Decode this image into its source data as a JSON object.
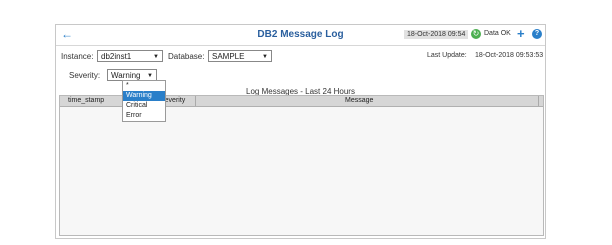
{
  "header": {
    "title": "DB2 Message Log",
    "datetime": "18-Oct-2018 09:54",
    "status_label": "Data OK"
  },
  "filters": {
    "instance_label": "Instance:",
    "instance_value": "db2inst1",
    "database_label": "Database:",
    "database_value": "SAMPLE",
    "last_update_label": "Last Update:",
    "last_update_value": "18-Oct-2018 09:53:53",
    "severity_label": "Severity:",
    "severity_value": "Warning"
  },
  "severity_dropdown": {
    "options": [
      "*",
      "Warning",
      "Critical",
      "Error"
    ],
    "selected": "Warning"
  },
  "table": {
    "title": "Log Messages - Last 24 Hours",
    "columns": [
      "time_stamp",
      "Severity",
      "Message"
    ]
  },
  "colors": {
    "accent": "#2a7fc9",
    "title": "#2a5f9e",
    "status_ok": "#4caf50"
  }
}
